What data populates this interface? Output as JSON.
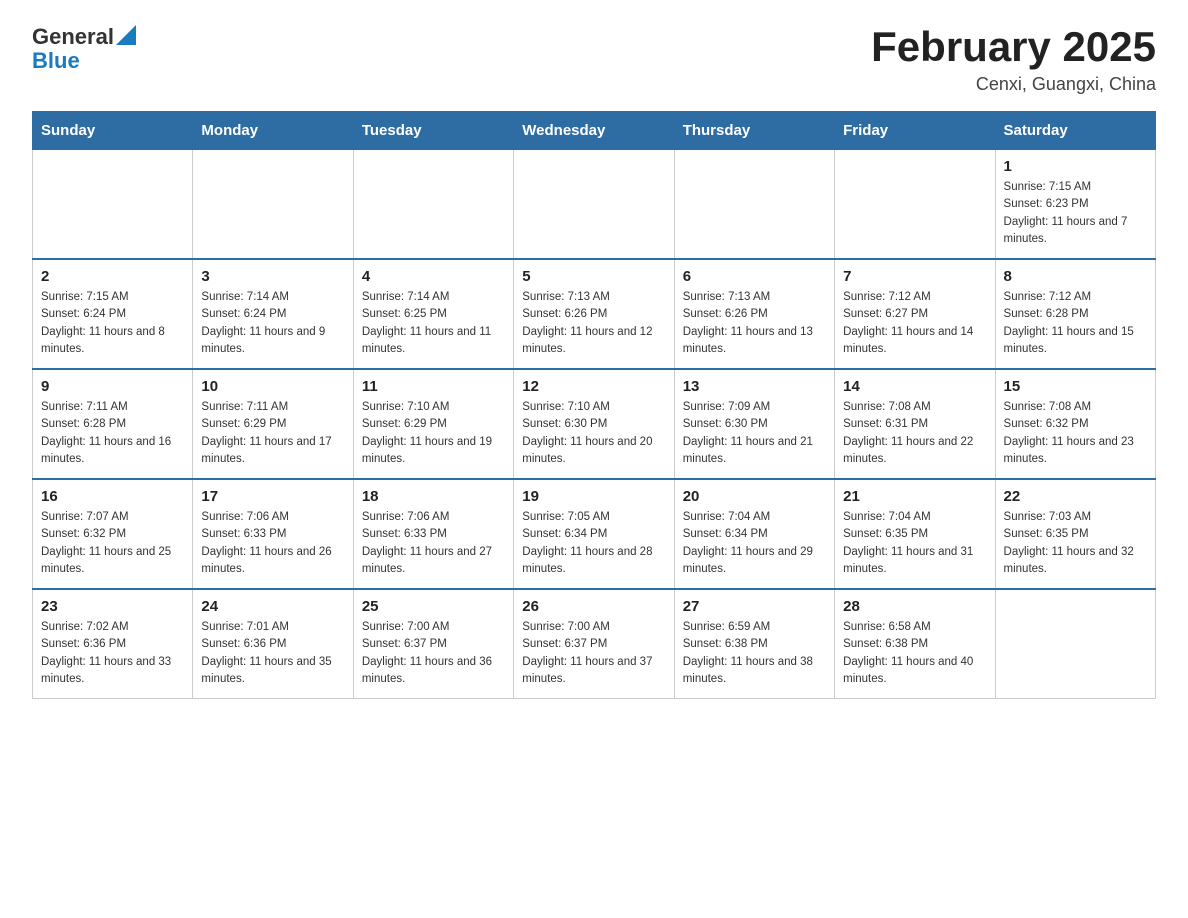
{
  "header": {
    "logo_general": "General",
    "logo_blue": "Blue",
    "title": "February 2025",
    "subtitle": "Cenxi, Guangxi, China"
  },
  "weekdays": [
    "Sunday",
    "Monday",
    "Tuesday",
    "Wednesday",
    "Thursday",
    "Friday",
    "Saturday"
  ],
  "weeks": [
    [
      {
        "day": "",
        "sunrise": "",
        "sunset": "",
        "daylight": ""
      },
      {
        "day": "",
        "sunrise": "",
        "sunset": "",
        "daylight": ""
      },
      {
        "day": "",
        "sunrise": "",
        "sunset": "",
        "daylight": ""
      },
      {
        "day": "",
        "sunrise": "",
        "sunset": "",
        "daylight": ""
      },
      {
        "day": "",
        "sunrise": "",
        "sunset": "",
        "daylight": ""
      },
      {
        "day": "",
        "sunrise": "",
        "sunset": "",
        "daylight": ""
      },
      {
        "day": "1",
        "sunrise": "Sunrise: 7:15 AM",
        "sunset": "Sunset: 6:23 PM",
        "daylight": "Daylight: 11 hours and 7 minutes."
      }
    ],
    [
      {
        "day": "2",
        "sunrise": "Sunrise: 7:15 AM",
        "sunset": "Sunset: 6:24 PM",
        "daylight": "Daylight: 11 hours and 8 minutes."
      },
      {
        "day": "3",
        "sunrise": "Sunrise: 7:14 AM",
        "sunset": "Sunset: 6:24 PM",
        "daylight": "Daylight: 11 hours and 9 minutes."
      },
      {
        "day": "4",
        "sunrise": "Sunrise: 7:14 AM",
        "sunset": "Sunset: 6:25 PM",
        "daylight": "Daylight: 11 hours and 11 minutes."
      },
      {
        "day": "5",
        "sunrise": "Sunrise: 7:13 AM",
        "sunset": "Sunset: 6:26 PM",
        "daylight": "Daylight: 11 hours and 12 minutes."
      },
      {
        "day": "6",
        "sunrise": "Sunrise: 7:13 AM",
        "sunset": "Sunset: 6:26 PM",
        "daylight": "Daylight: 11 hours and 13 minutes."
      },
      {
        "day": "7",
        "sunrise": "Sunrise: 7:12 AM",
        "sunset": "Sunset: 6:27 PM",
        "daylight": "Daylight: 11 hours and 14 minutes."
      },
      {
        "day": "8",
        "sunrise": "Sunrise: 7:12 AM",
        "sunset": "Sunset: 6:28 PM",
        "daylight": "Daylight: 11 hours and 15 minutes."
      }
    ],
    [
      {
        "day": "9",
        "sunrise": "Sunrise: 7:11 AM",
        "sunset": "Sunset: 6:28 PM",
        "daylight": "Daylight: 11 hours and 16 minutes."
      },
      {
        "day": "10",
        "sunrise": "Sunrise: 7:11 AM",
        "sunset": "Sunset: 6:29 PM",
        "daylight": "Daylight: 11 hours and 17 minutes."
      },
      {
        "day": "11",
        "sunrise": "Sunrise: 7:10 AM",
        "sunset": "Sunset: 6:29 PM",
        "daylight": "Daylight: 11 hours and 19 minutes."
      },
      {
        "day": "12",
        "sunrise": "Sunrise: 7:10 AM",
        "sunset": "Sunset: 6:30 PM",
        "daylight": "Daylight: 11 hours and 20 minutes."
      },
      {
        "day": "13",
        "sunrise": "Sunrise: 7:09 AM",
        "sunset": "Sunset: 6:30 PM",
        "daylight": "Daylight: 11 hours and 21 minutes."
      },
      {
        "day": "14",
        "sunrise": "Sunrise: 7:08 AM",
        "sunset": "Sunset: 6:31 PM",
        "daylight": "Daylight: 11 hours and 22 minutes."
      },
      {
        "day": "15",
        "sunrise": "Sunrise: 7:08 AM",
        "sunset": "Sunset: 6:32 PM",
        "daylight": "Daylight: 11 hours and 23 minutes."
      }
    ],
    [
      {
        "day": "16",
        "sunrise": "Sunrise: 7:07 AM",
        "sunset": "Sunset: 6:32 PM",
        "daylight": "Daylight: 11 hours and 25 minutes."
      },
      {
        "day": "17",
        "sunrise": "Sunrise: 7:06 AM",
        "sunset": "Sunset: 6:33 PM",
        "daylight": "Daylight: 11 hours and 26 minutes."
      },
      {
        "day": "18",
        "sunrise": "Sunrise: 7:06 AM",
        "sunset": "Sunset: 6:33 PM",
        "daylight": "Daylight: 11 hours and 27 minutes."
      },
      {
        "day": "19",
        "sunrise": "Sunrise: 7:05 AM",
        "sunset": "Sunset: 6:34 PM",
        "daylight": "Daylight: 11 hours and 28 minutes."
      },
      {
        "day": "20",
        "sunrise": "Sunrise: 7:04 AM",
        "sunset": "Sunset: 6:34 PM",
        "daylight": "Daylight: 11 hours and 29 minutes."
      },
      {
        "day": "21",
        "sunrise": "Sunrise: 7:04 AM",
        "sunset": "Sunset: 6:35 PM",
        "daylight": "Daylight: 11 hours and 31 minutes."
      },
      {
        "day": "22",
        "sunrise": "Sunrise: 7:03 AM",
        "sunset": "Sunset: 6:35 PM",
        "daylight": "Daylight: 11 hours and 32 minutes."
      }
    ],
    [
      {
        "day": "23",
        "sunrise": "Sunrise: 7:02 AM",
        "sunset": "Sunset: 6:36 PM",
        "daylight": "Daylight: 11 hours and 33 minutes."
      },
      {
        "day": "24",
        "sunrise": "Sunrise: 7:01 AM",
        "sunset": "Sunset: 6:36 PM",
        "daylight": "Daylight: 11 hours and 35 minutes."
      },
      {
        "day": "25",
        "sunrise": "Sunrise: 7:00 AM",
        "sunset": "Sunset: 6:37 PM",
        "daylight": "Daylight: 11 hours and 36 minutes."
      },
      {
        "day": "26",
        "sunrise": "Sunrise: 7:00 AM",
        "sunset": "Sunset: 6:37 PM",
        "daylight": "Daylight: 11 hours and 37 minutes."
      },
      {
        "day": "27",
        "sunrise": "Sunrise: 6:59 AM",
        "sunset": "Sunset: 6:38 PM",
        "daylight": "Daylight: 11 hours and 38 minutes."
      },
      {
        "day": "28",
        "sunrise": "Sunrise: 6:58 AM",
        "sunset": "Sunset: 6:38 PM",
        "daylight": "Daylight: 11 hours and 40 minutes."
      },
      {
        "day": "",
        "sunrise": "",
        "sunset": "",
        "daylight": ""
      }
    ]
  ]
}
